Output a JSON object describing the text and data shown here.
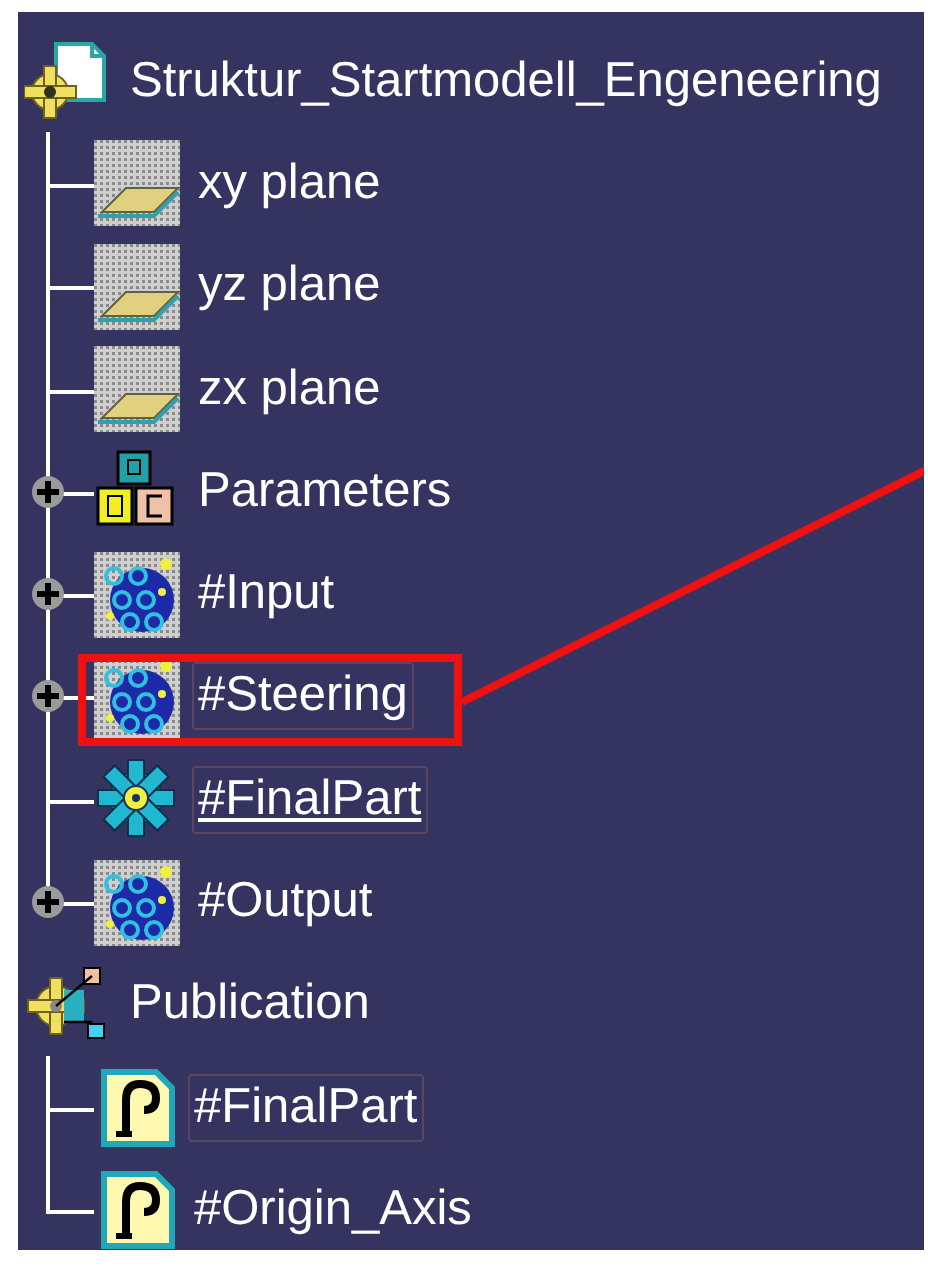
{
  "trees": [
    {
      "label": "Struktur_Startmodell_Engeneering",
      "kind": "part",
      "children": [
        {
          "label": "xy plane",
          "kind": "plane",
          "expandable": false,
          "framed": false,
          "underlined": false,
          "highlighted": false
        },
        {
          "label": "yz plane",
          "kind": "plane",
          "expandable": false,
          "framed": false,
          "underlined": false,
          "highlighted": false
        },
        {
          "label": "zx plane",
          "kind": "plane",
          "expandable": false,
          "framed": false,
          "underlined": false,
          "highlighted": false
        },
        {
          "label": "Parameters",
          "kind": "parameters",
          "expandable": true,
          "framed": false,
          "underlined": false,
          "highlighted": false
        },
        {
          "label": "#Input",
          "kind": "geoset",
          "expandable": true,
          "framed": false,
          "underlined": false,
          "highlighted": false
        },
        {
          "label": "#Steering",
          "kind": "geoset",
          "expandable": true,
          "framed": true,
          "underlined": false,
          "highlighted": true
        },
        {
          "label": "#FinalPart",
          "kind": "body",
          "expandable": false,
          "framed": true,
          "underlined": true,
          "highlighted": false
        },
        {
          "label": "#Output",
          "kind": "geoset",
          "expandable": true,
          "framed": false,
          "underlined": false,
          "highlighted": false
        }
      ]
    },
    {
      "label": "Publication",
      "kind": "publication",
      "children": [
        {
          "label": "#FinalPart",
          "kind": "published",
          "expandable": false,
          "framed": true,
          "underlined": false,
          "highlighted": false
        },
        {
          "label": "#Origin_Axis",
          "kind": "published",
          "expandable": false,
          "framed": false,
          "underlined": false,
          "highlighted": false
        }
      ]
    }
  ]
}
